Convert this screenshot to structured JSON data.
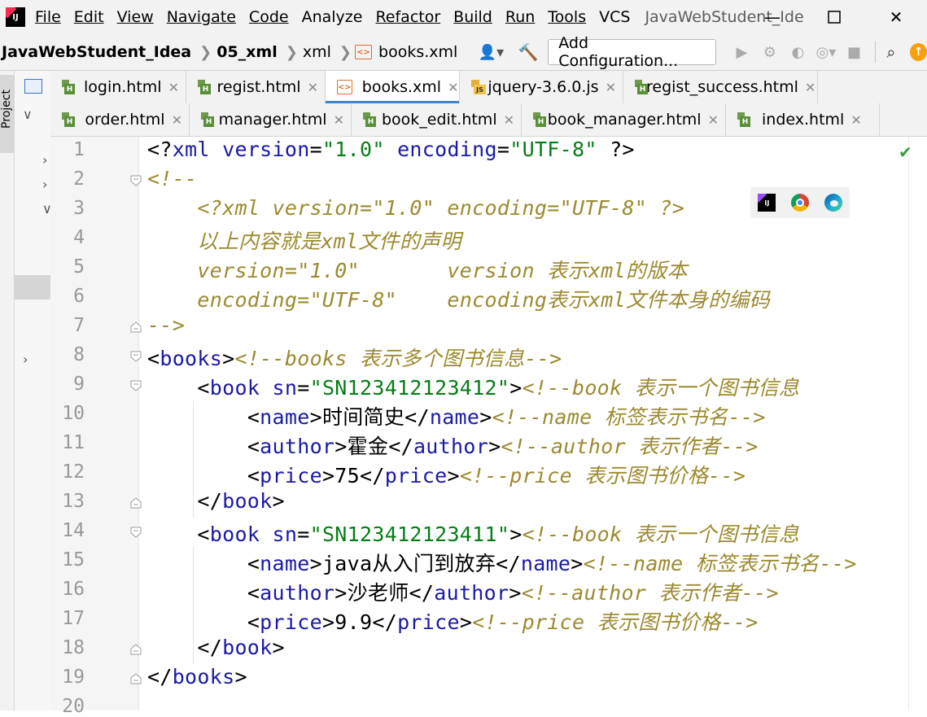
{
  "menu": {
    "items": [
      "File",
      "Edit",
      "View",
      "Navigate",
      "Code",
      "Analyze",
      "Refactor",
      "Build",
      "Run",
      "Tools",
      "VCS"
    ],
    "window_title": "JavaWebStudent_Ide"
  },
  "nav": {
    "project": "JavaWebStudent_Idea",
    "module": "05_xml",
    "folder": "xml",
    "file": "books.xml",
    "add_config": "Add Configuration..."
  },
  "sidebar": {
    "project_label": "Project"
  },
  "tabs_row1": [
    {
      "label": "login.html",
      "type": "html"
    },
    {
      "label": "regist.html",
      "type": "html"
    },
    {
      "label": "books.xml",
      "type": "xml",
      "active": true
    },
    {
      "label": "jquery-3.6.0.js",
      "type": "js"
    },
    {
      "label": "regist_success.html",
      "type": "html"
    }
  ],
  "tabs_row2": [
    {
      "label": "order.html",
      "type": "html"
    },
    {
      "label": "manager.html",
      "type": "html"
    },
    {
      "label": "book_edit.html",
      "type": "html"
    },
    {
      "label": "book_manager.html",
      "type": "html"
    },
    {
      "label": "index.html",
      "type": "html"
    }
  ],
  "editor": {
    "line_numbers": [
      "1",
      "2",
      "3",
      "4",
      "5",
      "6",
      "7",
      "8",
      "9",
      "10",
      "11",
      "12",
      "13",
      "14",
      "15",
      "16",
      "17",
      "18",
      "19",
      "20"
    ],
    "lines": [
      {
        "t": "<?xml version=\"1.0\" encoding=\"UTF-8\" ?>"
      },
      {
        "t": "<!--"
      },
      {
        "t": "    <?xml version=\"1.0\" encoding=\"UTF-8\" ?>"
      },
      {
        "t": "    以上内容就是xml文件的声明"
      },
      {
        "t": "    version=\"1.0\"       version 表示xml的版本"
      },
      {
        "t": "    encoding=\"UTF-8\"    encoding表示xml文件本身的编码"
      },
      {
        "t": "-->"
      },
      {
        "t": "<books><!--books 表示多个图书信息-->"
      },
      {
        "t": "    <book sn=\"SN123412123412\"><!--book 表示一个图书信息"
      },
      {
        "t": "        <name>时间简史</name><!--name 标签表示书名-->"
      },
      {
        "t": "        <author>霍金</author><!--author 表示作者-->"
      },
      {
        "t": "        <price>75</price><!--price 表示图书价格-->"
      },
      {
        "t": "    </book>"
      },
      {
        "t": "    <book sn=\"SN123412123411\"><!--book 表示一个图书信息"
      },
      {
        "t": "        <name>java从入门到放弃</name><!--name 标签表示书名-->"
      },
      {
        "t": "        <author>沙老师</author><!--author 表示作者-->"
      },
      {
        "t": "        <price>9.9</price><!--price 表示图书价格-->"
      },
      {
        "t": "    </book>"
      },
      {
        "t": "</books>"
      },
      {
        "t": ""
      }
    ]
  },
  "colors": {
    "accent": "#4083c9",
    "tag": "#1a1aa6",
    "value": "#067d17",
    "comment": "#9b8a2f"
  }
}
